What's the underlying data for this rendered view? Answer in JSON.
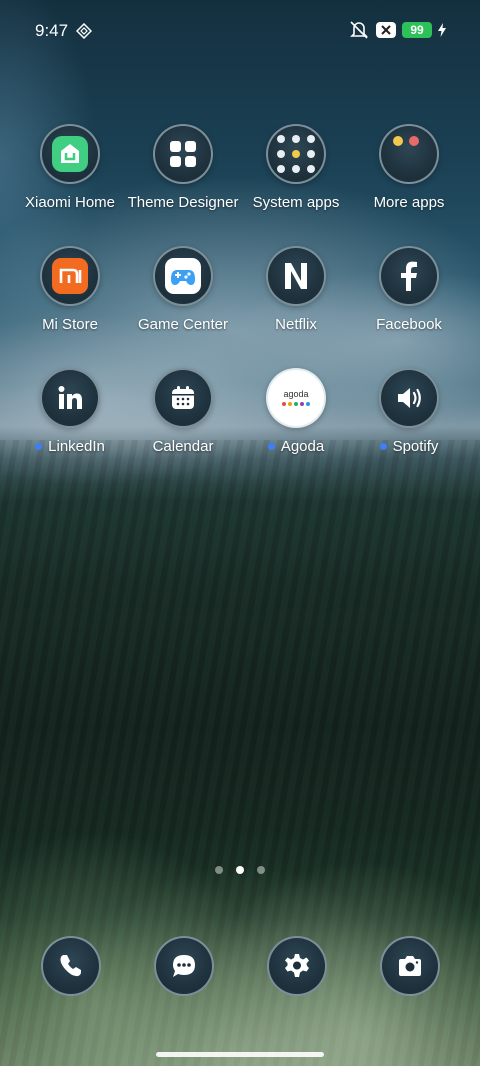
{
  "status_bar": {
    "time": "9:47",
    "battery_level": "99",
    "battery_color": "#2ec15a"
  },
  "apps": [
    {
      "label": "Xiaomi Home",
      "icon": "xiaomi-home-icon",
      "new": false
    },
    {
      "label": "Theme Designer",
      "icon": "theme-designer-icon",
      "new": false
    },
    {
      "label": "System apps",
      "icon": "system-apps-folder-icon",
      "new": false
    },
    {
      "label": "More apps",
      "icon": "more-apps-folder-icon",
      "new": false
    },
    {
      "label": "Mi Store",
      "icon": "mi-store-icon",
      "new": false
    },
    {
      "label": "Game Center",
      "icon": "game-center-icon",
      "new": false
    },
    {
      "label": "Netflix",
      "icon": "netflix-icon",
      "new": false
    },
    {
      "label": "Facebook",
      "icon": "facebook-icon",
      "new": false
    },
    {
      "label": "LinkedIn",
      "icon": "linkedin-icon",
      "new": true
    },
    {
      "label": "Calendar",
      "icon": "calendar-icon",
      "new": false
    },
    {
      "label": "Agoda",
      "icon": "agoda-icon",
      "new": true,
      "icon_text": "agoda"
    },
    {
      "label": "Spotify",
      "icon": "spotify-icon",
      "new": true
    }
  ],
  "page_indicator": {
    "pages": 3,
    "active": 2
  },
  "dock": [
    {
      "icon": "phone-icon"
    },
    {
      "icon": "messages-icon"
    },
    {
      "icon": "settings-icon"
    },
    {
      "icon": "camera-icon"
    }
  ],
  "accent_new_dot_color": "#3f7ef6"
}
